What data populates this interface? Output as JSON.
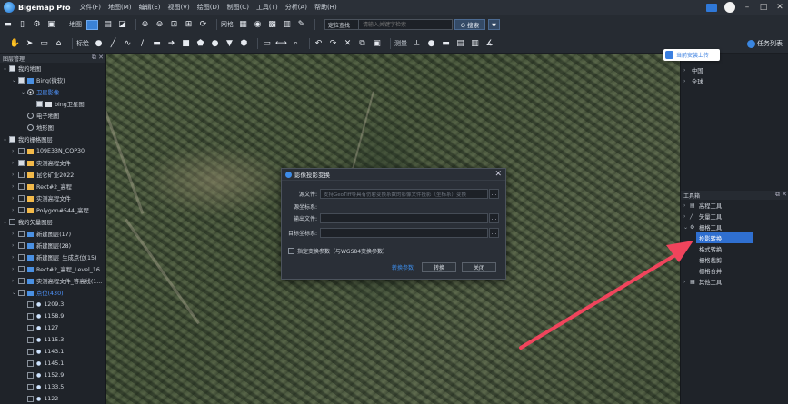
{
  "app": {
    "title": "Bigemap Pro",
    "menu": [
      "文件(F)",
      "地图(M)",
      "编辑(E)",
      "视图(V)",
      "绘图(D)",
      "制图(C)",
      "工具(T)",
      "分析(A)",
      "帮助(H)"
    ]
  },
  "toolbar1": {
    "map_label": "地图",
    "grid_label": "网格",
    "search_mode": "定位查找",
    "search_placeholder": "请输入关键字检索",
    "search_button": "Q 搜索"
  },
  "toolbar2": {
    "label_label": "标绘",
    "measure_label": "测量",
    "tasklist_label": "任务列表"
  },
  "layers_panel": {
    "title": "图层管理",
    "rows": [
      {
        "indent": 0,
        "arrow": "v",
        "check": "checked",
        "icon": "",
        "label": "我的地图"
      },
      {
        "indent": 1,
        "arrow": "v",
        "check": "checked",
        "icon": "map",
        "label": "Bing(微软)"
      },
      {
        "indent": 2,
        "arrow": "v",
        "check": "radio-on",
        "icon": "",
        "label": "卫星影像",
        "selected": true
      },
      {
        "indent": 3,
        "arrow": "",
        "check": "checked",
        "icon": "img",
        "label": "bing卫星图"
      },
      {
        "indent": 2,
        "arrow": "",
        "check": "radio",
        "icon": "",
        "label": "电子地图"
      },
      {
        "indent": 2,
        "arrow": "",
        "check": "radio",
        "icon": "",
        "label": "地形图"
      },
      {
        "indent": 0,
        "arrow": "v",
        "check": "checked",
        "icon": "",
        "label": "我的栅格图层"
      },
      {
        "indent": 1,
        "arrow": ">",
        "check": "box",
        "icon": "folder",
        "label": "109E33N_COP30"
      },
      {
        "indent": 1,
        "arrow": ">",
        "check": "checked",
        "icon": "folder",
        "label": "实测高程文件"
      },
      {
        "indent": 1,
        "arrow": ">",
        "check": "box",
        "icon": "folder",
        "label": "昆仑矿业2022"
      },
      {
        "indent": 1,
        "arrow": ">",
        "check": "box",
        "icon": "folder",
        "label": "Rect#2_高程"
      },
      {
        "indent": 1,
        "arrow": ">",
        "check": "box",
        "icon": "folder",
        "label": "实测高程文件"
      },
      {
        "indent": 1,
        "arrow": ">",
        "check": "box",
        "icon": "folder",
        "label": "Polygon#544_高程"
      },
      {
        "indent": 0,
        "arrow": "v",
        "check": "box",
        "icon": "",
        "label": "我的矢量图层"
      },
      {
        "indent": 1,
        "arrow": ">",
        "check": "box",
        "icon": "vec",
        "label": "新建图层(17)"
      },
      {
        "indent": 1,
        "arrow": ">",
        "check": "box",
        "icon": "vec",
        "label": "新建图层(28)"
      },
      {
        "indent": 1,
        "arrow": ">",
        "check": "box",
        "icon": "vec",
        "label": "新建图层_生成点位(15)"
      },
      {
        "indent": 1,
        "arrow": ">",
        "check": "box",
        "icon": "vec",
        "label": "Rect#2_高程_Level_16..."
      },
      {
        "indent": 1,
        "arrow": ">",
        "check": "box",
        "icon": "vec",
        "label": "实测高程文件_等高线(1..."
      },
      {
        "indent": 1,
        "arrow": "v",
        "check": "box",
        "icon": "vec",
        "label": "点位(430)",
        "selected": true
      },
      {
        "indent": 2,
        "arrow": "",
        "check": "box",
        "icon": "pin",
        "label": "1209.3"
      },
      {
        "indent": 2,
        "arrow": "",
        "check": "box",
        "icon": "pin",
        "label": "1158.9"
      },
      {
        "indent": 2,
        "arrow": "",
        "check": "box",
        "icon": "pin",
        "label": "1127"
      },
      {
        "indent": 2,
        "arrow": "",
        "check": "box",
        "icon": "pin",
        "label": "1115.3"
      },
      {
        "indent": 2,
        "arrow": "",
        "check": "box",
        "icon": "pin",
        "label": "1143.1"
      },
      {
        "indent": 2,
        "arrow": "",
        "check": "box",
        "icon": "pin",
        "label": "1145.1"
      },
      {
        "indent": 2,
        "arrow": "",
        "check": "box",
        "icon": "pin",
        "label": "1152.9"
      },
      {
        "indent": 2,
        "arrow": "",
        "check": "box",
        "icon": "pin",
        "label": "1133.5"
      },
      {
        "indent": 2,
        "arrow": "",
        "check": "box",
        "icon": "pin",
        "label": "1122"
      }
    ]
  },
  "dialog": {
    "title": "影像投影变换",
    "source_label": "源文件:",
    "source_placeholder": "支持GeoTiff等具有仿射变换系数的影像文件投影（坐标系）变换",
    "src_crs_label": "源坐标系:",
    "output_label": "输出文件:",
    "target_crs_label": "目标坐标系:",
    "checkbox_label": "指定变换参数（与WGS84变换参数）",
    "more": "...",
    "btn_primary": "转换参数",
    "btn_convert": "转换",
    "btn_close": "关闭"
  },
  "right_panel": {
    "cloud_button": "当前安装上传",
    "regions": [
      {
        "arrow": ">",
        "label": "中国"
      },
      {
        "arrow": ">",
        "label": "全球"
      }
    ],
    "tools_title": "工具箱",
    "tools": [
      {
        "arrow": ">",
        "icon": "tool",
        "label": "高程工具"
      },
      {
        "arrow": ">",
        "icon": "vector",
        "label": "矢量工具"
      },
      {
        "arrow": "v",
        "icon": "raster",
        "label": "栅格工具"
      }
    ],
    "raster_sub": [
      "投影转换",
      "格式转换",
      "栅格裁剪",
      "栅格合并"
    ],
    "other_tools": {
      "arrow": ">",
      "icon": "grid",
      "label": "其他工具"
    }
  },
  "colors": {
    "accent": "#3d8ce8",
    "selection": "#2f6fd0",
    "arrow": "#f0445c"
  }
}
